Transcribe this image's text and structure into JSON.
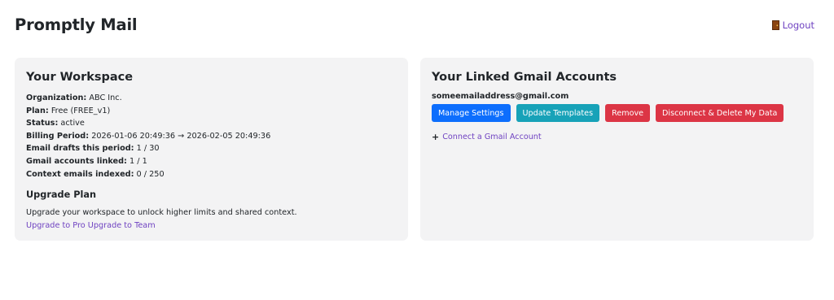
{
  "app": {
    "title": "Promptly Mail"
  },
  "header": {
    "logout_label": "Logout",
    "logout_icon": "door-icon"
  },
  "workspace": {
    "title": "Your Workspace",
    "fields": [
      {
        "label": "Organization:",
        "value": " ABC Inc."
      },
      {
        "label": "Plan:",
        "value": " Free (FREE_v1)"
      },
      {
        "label": "Status:",
        "value": " active"
      },
      {
        "label": "Billing Period:",
        "value": " 2026-01-06 20:49:36 → 2026-02-05 20:49:36"
      },
      {
        "label": "Email drafts this period:",
        "value": " 1 / 30"
      },
      {
        "label": "Gmail accounts linked:",
        "value": " 1 / 1"
      },
      {
        "label": "Context emails indexed:",
        "value": " 0 / 250"
      }
    ],
    "upgrade": {
      "title": "Upgrade Plan",
      "text": "Upgrade your workspace to unlock higher limits and shared context.",
      "pro_label": "Upgrade to Pro",
      "team_label": "Upgrade to Team"
    }
  },
  "gmail": {
    "title": "Your Linked Gmail Accounts",
    "accounts": [
      {
        "email": "someemailaddress@gmail.com",
        "buttons": {
          "manage": "Manage Settings",
          "templates": "Update Templates",
          "remove": "Remove",
          "disconnect": "Disconnect & Delete My Data"
        }
      }
    ],
    "connect_label": "Connect a Gmail Account",
    "connect_icon": "plus-icon"
  },
  "colors": {
    "link": "#6f42c1",
    "primary": "#0d6efd",
    "info": "#17a2b8",
    "danger": "#dc3545",
    "card_bg": "#f3f3f4"
  }
}
